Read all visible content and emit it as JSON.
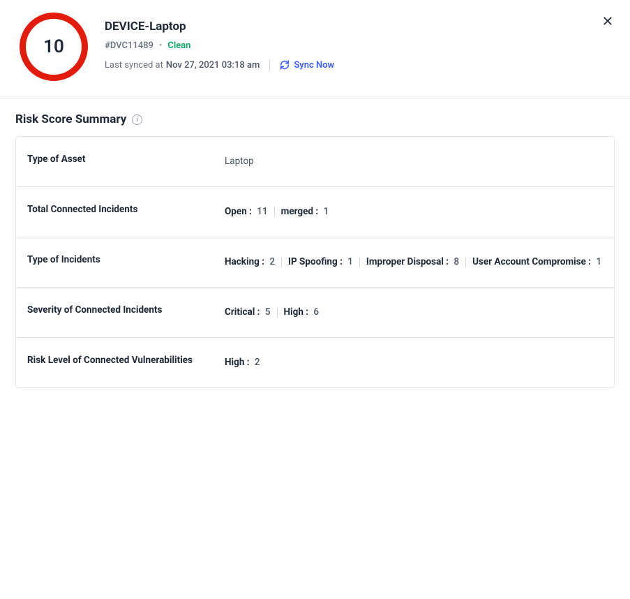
{
  "header": {
    "score": "10",
    "title": "DEVICE-Laptop",
    "deviceId": "#DVC11489",
    "status": "Clean",
    "lastSyncedLabel": "Last synced at",
    "lastSyncedAt": "Nov 27, 2021 03:18 am",
    "syncNowLabel": "Sync Now",
    "scoreColor": "#e31b0c"
  },
  "section": {
    "title": "Risk Score Summary"
  },
  "rows": [
    {
      "label": "Type of Asset",
      "plain": "Laptop"
    },
    {
      "label": "Total Connected Incidents",
      "pairs": [
        {
          "k": "Open :",
          "v": "11"
        },
        {
          "k": "merged :",
          "v": "1"
        }
      ]
    },
    {
      "label": "Type of Incidents",
      "pairs": [
        {
          "k": "Hacking :",
          "v": "2"
        },
        {
          "k": "IP Spoofing :",
          "v": "1"
        },
        {
          "k": "Improper Disposal :",
          "v": "8"
        },
        {
          "k": "User Account Compromise :",
          "v": "1"
        }
      ]
    },
    {
      "label": "Severity of Connected Incidents",
      "pairs": [
        {
          "k": "Critical :",
          "v": "5"
        },
        {
          "k": "High :",
          "v": "6"
        }
      ]
    },
    {
      "label": "Risk Level of Connected Vulnerabilities",
      "pairs": [
        {
          "k": "High :",
          "v": "2"
        }
      ]
    }
  ]
}
